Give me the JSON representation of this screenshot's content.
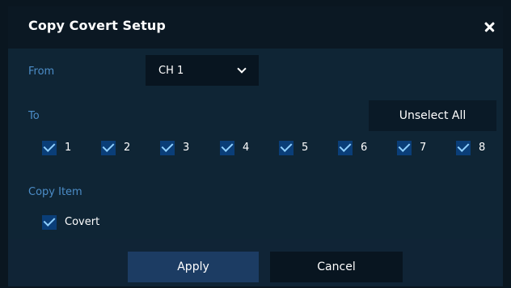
{
  "dialog": {
    "title": "Copy Covert Setup",
    "close_icon": "close-icon"
  },
  "from": {
    "label": "From",
    "selected": "CH 1",
    "chevron_icon": "chevron-down-icon"
  },
  "to": {
    "label": "To",
    "unselect_all_label": "Unselect All",
    "channels": [
      {
        "label": "1",
        "checked": true
      },
      {
        "label": "2",
        "checked": true
      },
      {
        "label": "3",
        "checked": true
      },
      {
        "label": "4",
        "checked": true
      },
      {
        "label": "5",
        "checked": true
      },
      {
        "label": "6",
        "checked": true
      },
      {
        "label": "7",
        "checked": true
      },
      {
        "label": "8",
        "checked": true
      }
    ]
  },
  "copy_item": {
    "label": "Copy Item",
    "items": [
      {
        "label": "Covert",
        "checked": true
      }
    ]
  },
  "buttons": {
    "apply_label": "Apply",
    "cancel_label": "Cancel"
  },
  "colors": {
    "accent_label": "#4c8dc8",
    "checkbox_fill": "#0a3e78",
    "checkmark": "#8fd0ff",
    "apply_bg": "#1c3c63"
  }
}
